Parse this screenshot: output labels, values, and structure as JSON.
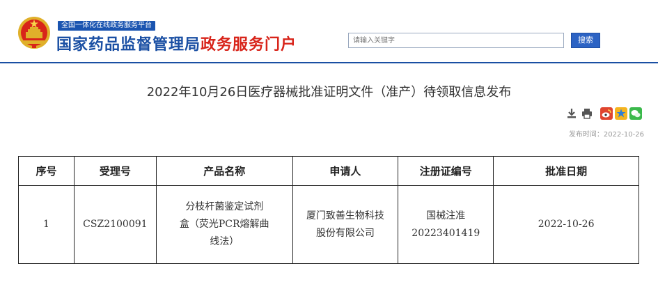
{
  "header": {
    "portal_tag": "全国一体化在线政务服务平台",
    "title_part1": "国家药品监督管理局",
    "title_part2": "政务服务门户",
    "search_placeholder": "请输入关键字",
    "search_button": "搜索"
  },
  "article": {
    "title": "2022年10月26日医疗器械批准证明文件（准产）待领取信息发布",
    "publish_time": "发布时间：2022-10-26",
    "tool_icons": [
      "download-icon",
      "print-icon",
      "weibo-icon",
      "qzone-icon",
      "wechat-icon"
    ]
  },
  "table": {
    "headers": [
      "序号",
      "受理号",
      "产品名称",
      "申请人",
      "注册证编号",
      "批准日期"
    ],
    "rows": [
      {
        "seq": "1",
        "accept_no": "CSZ2100091",
        "product_line1": "分枝杆菌鉴定试剂",
        "product_line2": "盒（荧光PCR熔解曲",
        "product_line3": "线法）",
        "applicant_line1": "厦门致善生物科技",
        "applicant_line2": "股份有限公司",
        "cert_line1": "国械注准",
        "cert_line2": "20223401419",
        "approve_date": "2022-10-26"
      }
    ]
  },
  "colors": {
    "brand_blue": "#1a4fa3",
    "brand_red": "#d8241a",
    "button_blue": "#2c63c4"
  }
}
